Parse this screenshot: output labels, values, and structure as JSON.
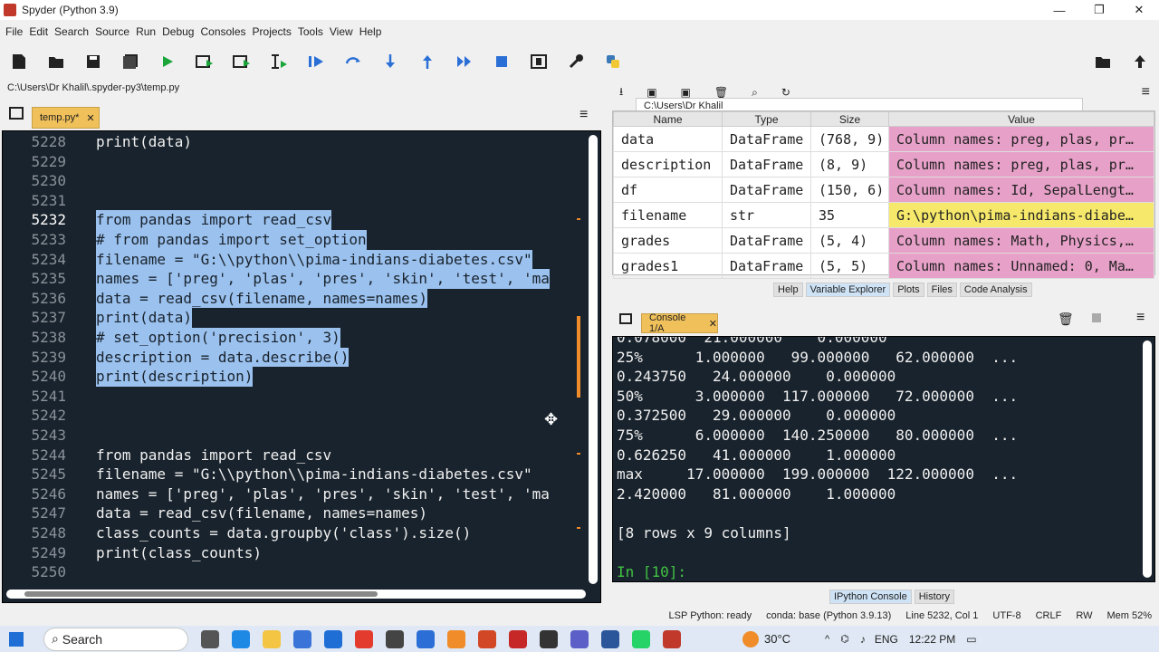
{
  "window": {
    "title": "Spyder (Python 3.9)"
  },
  "menu": [
    "File",
    "Edit",
    "Search",
    "Source",
    "Run",
    "Debug",
    "Consoles",
    "Projects",
    "Tools",
    "View",
    "Help"
  ],
  "toolbar": {
    "path": "C:\\Users\\Dr Khalil"
  },
  "editor": {
    "filepath": "C:\\Users\\Dr Khalil\\.spyder-py3\\temp.py",
    "tab_label": "temp.py*",
    "lines": [
      {
        "n": "5228",
        "code": "print(data)"
      },
      {
        "n": "5229",
        "code": ""
      },
      {
        "n": "5230",
        "code": ""
      },
      {
        "n": "5231",
        "code": ""
      },
      {
        "n": "5232",
        "code": "from pandas import read_csv"
      },
      {
        "n": "5233",
        "code": "# from pandas import set_option"
      },
      {
        "n": "5234",
        "code": "filename = \"G:\\\\python\\\\pima-indians-diabetes.csv\""
      },
      {
        "n": "5235",
        "code": "names = ['preg', 'plas', 'pres', 'skin', 'test', 'ma"
      },
      {
        "n": "5236",
        "code": "data = read_csv(filename, names=names)"
      },
      {
        "n": "5237",
        "code": "print(data)"
      },
      {
        "n": "5238",
        "code": "# set_option('precision', 3)"
      },
      {
        "n": "5239",
        "code": "description = data.describe()"
      },
      {
        "n": "5240",
        "code": "print(description)"
      },
      {
        "n": "5241",
        "code": ""
      },
      {
        "n": "5242",
        "code": ""
      },
      {
        "n": "5243",
        "code": ""
      },
      {
        "n": "5244",
        "code": "from pandas import read_csv"
      },
      {
        "n": "5245",
        "code": "filename = \"G:\\\\python\\\\pima-indians-diabetes.csv\""
      },
      {
        "n": "5246",
        "code": "names = ['preg', 'plas', 'pres', 'skin', 'test', 'ma"
      },
      {
        "n": "5247",
        "code": "data = read_csv(filename, names=names)"
      },
      {
        "n": "5248",
        "code": "class_counts = data.groupby('class').size()"
      },
      {
        "n": "5249",
        "code": "print(class_counts)"
      },
      {
        "n": "5250",
        "code": ""
      }
    ]
  },
  "variable_explorer": {
    "headers": [
      "Name",
      "Type",
      "Size",
      "Value"
    ],
    "rows": [
      {
        "name": "data",
        "type": "DataFrame",
        "size": "(768, 9)",
        "value": "Column names: preg, plas, pr…",
        "color": "pink"
      },
      {
        "name": "description",
        "type": "DataFrame",
        "size": "(8, 9)",
        "value": "Column names: preg, plas, pr…",
        "color": "pink"
      },
      {
        "name": "df",
        "type": "DataFrame",
        "size": "(150, 6)",
        "value": "Column names: Id, SepalLengt…",
        "color": "pink"
      },
      {
        "name": "filename",
        "type": "str",
        "size": "35",
        "value": "G:\\python\\pima-indians-diabe…",
        "color": "yellow"
      },
      {
        "name": "grades",
        "type": "DataFrame",
        "size": "(5, 4)",
        "value": "Column names: Math, Physics,…",
        "color": "pink"
      },
      {
        "name": "grades1",
        "type": "DataFrame",
        "size": "(5, 5)",
        "value": "Column names: Unnamed: 0, Ma…",
        "color": "pink"
      }
    ],
    "tabs": [
      "Help",
      "Variable Explorer",
      "Plots",
      "Files",
      "Code Analysis"
    ]
  },
  "console": {
    "tab_label": "Console 1/A",
    "lines": [
      "0.078000  21.000000    0.000000",
      "25%      1.000000   99.000000   62.000000  ...",
      "0.243750   24.000000    0.000000",
      "50%      3.000000  117.000000   72.000000  ...",
      "0.372500   29.000000    0.000000",
      "75%      6.000000  140.250000   80.000000  ...",
      "0.626250   41.000000    1.000000",
      "max     17.000000  199.000000  122.000000  ...",
      "2.420000   81.000000    1.000000",
      "",
      "[8 rows x 9 columns]",
      ""
    ],
    "prompt": "In [10]:",
    "tabs": [
      "IPython Console",
      "History"
    ]
  },
  "status": {
    "lsp": "LSP Python: ready",
    "conda": "conda: base (Python 3.9.13)",
    "position": "Line 5232, Col 1",
    "encoding": "UTF-8",
    "eol": "CRLF",
    "rw": "RW",
    "mem": "Mem 52%"
  },
  "taskbar": {
    "search": "Search",
    "temp": "30°C",
    "lang": "ENG",
    "time": "12:22 PM"
  }
}
